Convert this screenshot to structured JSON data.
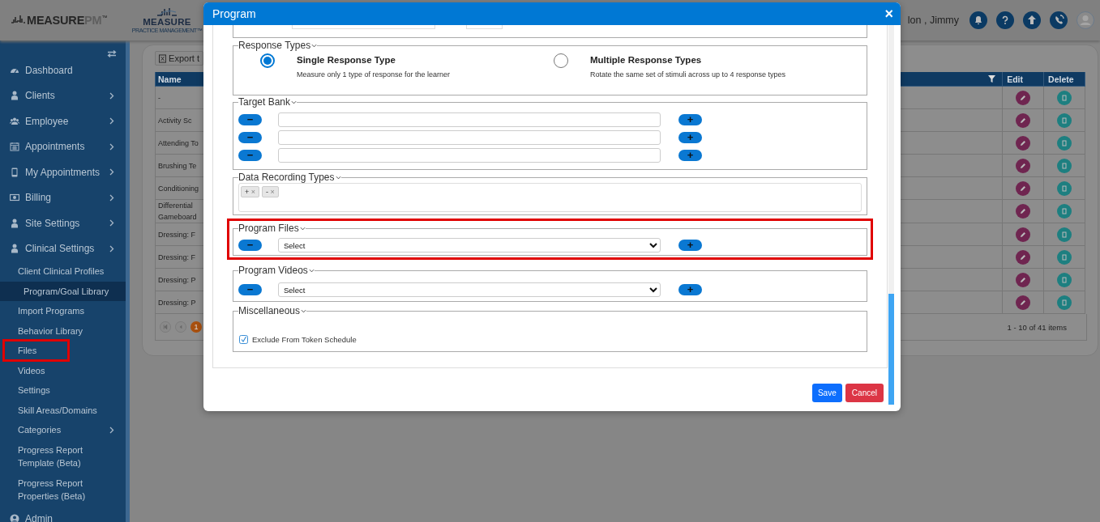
{
  "header": {
    "logo_brand": "MEASURE",
    "logo_suffix": "PM",
    "logo_trademark": "™",
    "logo2_name": "MEASURE",
    "logo2_tagline": "PRACTICE MANAGEMENT™",
    "user_name": "lon , Jimmy"
  },
  "sidebar": {
    "items": [
      {
        "label": "Dashboard",
        "has_submenu": false
      },
      {
        "label": "Clients",
        "has_submenu": true
      },
      {
        "label": "Employee",
        "has_submenu": true
      },
      {
        "label": "Appointments",
        "has_submenu": true
      },
      {
        "label": "My Appointments",
        "has_submenu": true
      },
      {
        "label": "Billing",
        "has_submenu": true
      },
      {
        "label": "Site Settings",
        "has_submenu": true
      },
      {
        "label": "Clinical Settings",
        "has_submenu": true,
        "children": [
          {
            "label": "Client Clinical Profiles",
            "has_submenu": false,
            "selected": false,
            "highlighted": false
          },
          {
            "label": "Program/Goal Library",
            "has_submenu": false,
            "selected": true,
            "highlighted": false
          },
          {
            "label": "Import Programs",
            "has_submenu": false,
            "selected": false,
            "highlighted": false
          },
          {
            "label": "Behavior Library",
            "has_submenu": false,
            "selected": false,
            "highlighted": false
          },
          {
            "label": "Files",
            "has_submenu": false,
            "selected": false,
            "highlighted": true
          },
          {
            "label": "Videos",
            "has_submenu": false,
            "selected": false,
            "highlighted": false
          },
          {
            "label": "Settings",
            "has_submenu": false,
            "selected": false,
            "highlighted": false
          },
          {
            "label": "Skill Areas/Domains",
            "has_submenu": false,
            "selected": false,
            "highlighted": false
          },
          {
            "label": "Categories",
            "has_submenu": true,
            "selected": false,
            "highlighted": false
          },
          {
            "label": "Progress Report Template (Beta)",
            "has_submenu": false,
            "selected": false,
            "highlighted": false
          },
          {
            "label": "Progress Report Properties (Beta)",
            "has_submenu": false,
            "selected": false,
            "highlighted": false
          }
        ]
      },
      {
        "label": "Admin",
        "has_submenu": false
      }
    ]
  },
  "table": {
    "export_button": "Export t",
    "columns": {
      "name": "Name",
      "edit": "Edit",
      "delete": "Delete"
    },
    "rows": [
      {
        "name": "-"
      },
      {
        "name": "Activity Sc"
      },
      {
        "name": "Attending To"
      },
      {
        "name": "Brushing Te"
      },
      {
        "name": "Conditioning"
      },
      {
        "name": "Differential\nGameboard"
      },
      {
        "name": "Dressing: F"
      },
      {
        "name": "Dressing: F"
      },
      {
        "name": "Dressing: P"
      },
      {
        "name": "Dressing: P"
      }
    ],
    "pager": {
      "current_page": "1",
      "summary": "1 - 10 of 41 items"
    }
  },
  "modal": {
    "title": "Program",
    "close": "×",
    "response_types": {
      "legend": "Response Types",
      "options": [
        {
          "title": "Single Response Type",
          "description": "Measure only 1 type of response for the learner",
          "selected": true
        },
        {
          "title": "Multiple Response Types",
          "description": "Rotate the same set of stimuli across up to 4 response types",
          "selected": false
        }
      ]
    },
    "target_bank": {
      "legend": "Target Bank",
      "rows": [
        {
          "remove": "−",
          "add": "+"
        },
        {
          "remove": "−",
          "add": "+"
        },
        {
          "remove": "−",
          "add": "+"
        }
      ]
    },
    "data_recording_types": {
      "legend": "Data Recording Types",
      "tags": [
        {
          "label": "+",
          "remove": "×"
        },
        {
          "label": "-",
          "remove": "×"
        }
      ]
    },
    "program_files": {
      "legend": "Program Files",
      "highlighted": true,
      "remove": "−",
      "select": "Select",
      "add": "+"
    },
    "program_videos": {
      "legend": "Program Videos",
      "highlighted": false,
      "remove": "−",
      "select": "Select",
      "add": "+"
    },
    "miscellaneous": {
      "legend": "Miscellaneous",
      "checkbox": {
        "label": "Exclude From Token Schedule",
        "checked": true
      }
    },
    "buttons": {
      "save": "Save",
      "cancel": "Cancel"
    }
  }
}
